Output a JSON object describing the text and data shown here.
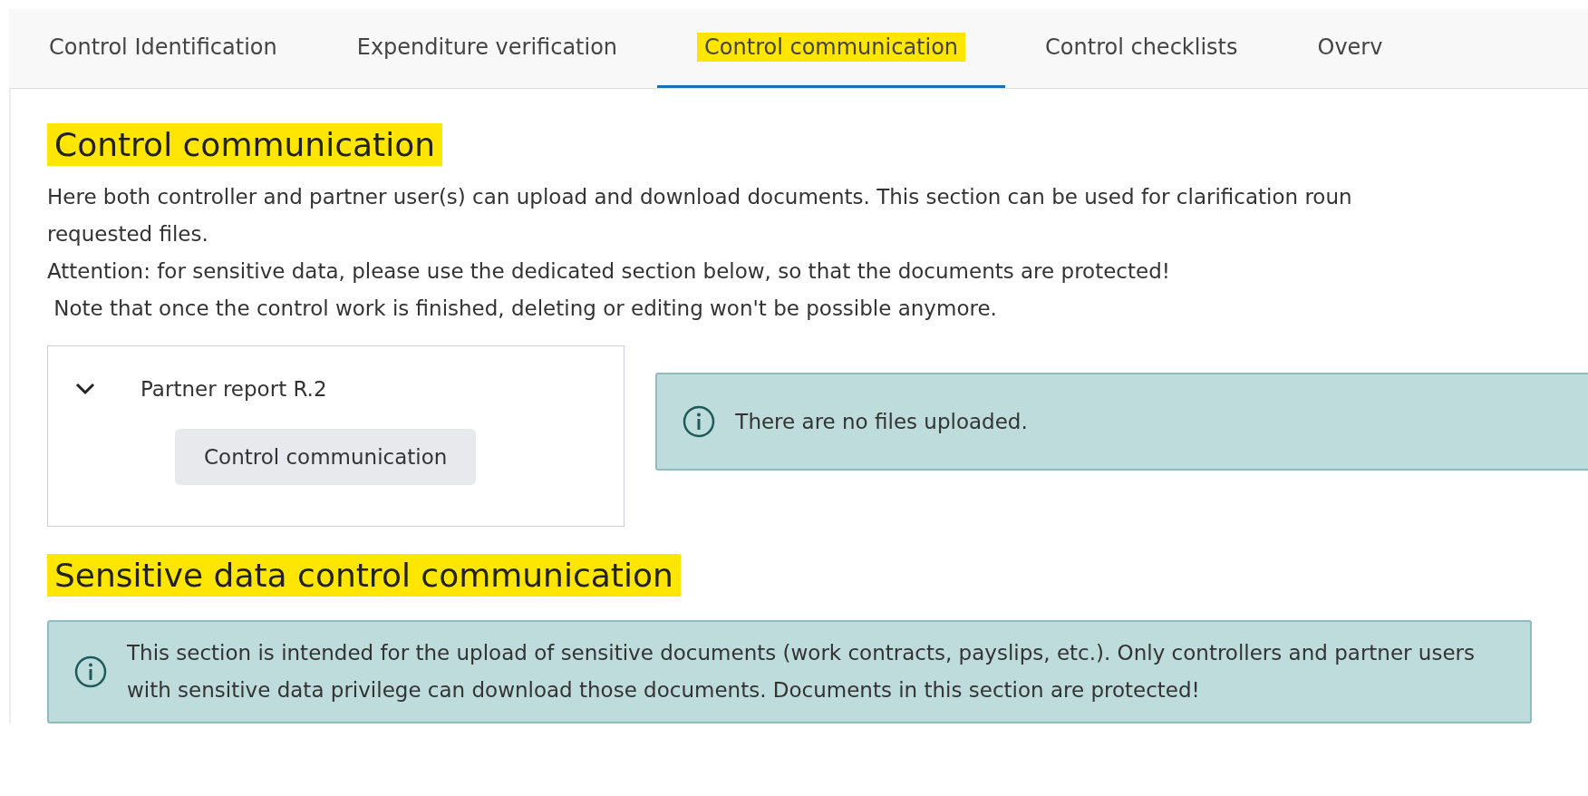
{
  "tabs": [
    {
      "label": "Control Identification",
      "selected": false,
      "highlighted": false
    },
    {
      "label": "Expenditure verification",
      "selected": false,
      "highlighted": false
    },
    {
      "label": "Control communication",
      "selected": true,
      "highlighted": true
    },
    {
      "label": "Control checklists",
      "selected": false,
      "highlighted": false
    },
    {
      "label": "Overv",
      "selected": false,
      "highlighted": false
    }
  ],
  "section": {
    "title": "Control communication",
    "highlighted": true,
    "description": [
      "Here both controller and partner user(s) can upload and download documents. This section can be used for clarification roun",
      "requested files.",
      "Attention: for sensitive data, please use the dedicated section below, so that the documents are protected!",
      " Note that once the control work is finished, deleting or editing won't be possible anymore."
    ],
    "tree": {
      "label": "Partner report R.2",
      "expanded": true,
      "children": [
        {
          "label": "Control communication",
          "selected": false
        }
      ]
    },
    "info": "There are no files uploaded."
  },
  "sensitive": {
    "title": "Sensitive data control communication",
    "highlighted": true,
    "info": "This section is intended for the upload of sensitive documents (work contracts, payslips, etc.). Only controllers and partner users with sensitive data privilege can download those documents. Documents in this section are protected!"
  }
}
